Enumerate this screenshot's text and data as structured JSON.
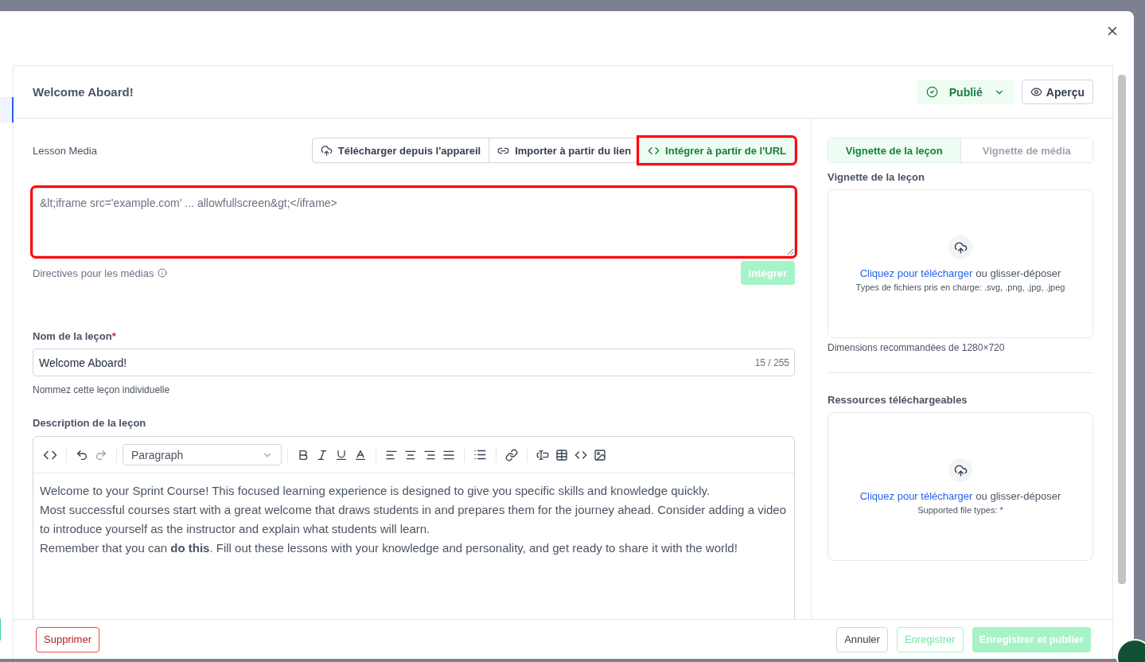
{
  "header": {
    "title": "Welcome Aboard!",
    "status": {
      "label": "Publié",
      "published": true
    },
    "preview_button": "Aperçu"
  },
  "media": {
    "label": "Lesson Media",
    "sources": [
      {
        "kind": "upload",
        "label": "Télécharger depuis l'appareil",
        "selected": false,
        "highlighted": false
      },
      {
        "kind": "link",
        "label": "Importer à partir du lien",
        "selected": false,
        "highlighted": false
      },
      {
        "kind": "code",
        "label": "Intégrer à partir de l'URL",
        "selected": true,
        "highlighted": true
      }
    ],
    "embed": {
      "placeholder": "&lt;iframe src='example.com' ... allowfullscreen&gt;</iframe>",
      "highlighted": true
    },
    "guidelines": "Directives pour les médias",
    "embed_button": {
      "label": "intégrer",
      "disabled": true
    }
  },
  "lesson_name": {
    "label": "Nom de la leçon",
    "required_mark": "*",
    "value": "Welcome Aboard!",
    "counter": "15 / 255",
    "hint": "Nommez cette leçon individuelle"
  },
  "description": {
    "label": "Description de la leçon",
    "block_format": "Paragraph",
    "paragraphs": [
      "Welcome to your Sprint Course! This focused learning experience is designed to give you specific skills and knowledge quickly.",
      "Most successful courses start with a great welcome that draws students in and prepares them for the journey ahead. Consider adding a video to introduce yourself as the instructor and explain what students will learn.",
      "Remember that you can **do this**. Fill out these lessons with your knowledge and personality, and get ready to share it with the world!"
    ]
  },
  "thumbnail": {
    "tabs": [
      {
        "label": "Vignette de la leçon",
        "selected": true
      },
      {
        "label": "Vignette de média",
        "selected": false
      }
    ],
    "label": "Vignette de la leçon",
    "upload": {
      "link": "Cliquez pour télécharger",
      "text": "ou glisser-déposer",
      "types": "Types de fichiers pris en charge: .svg, .png, .jpg, .jpeg"
    },
    "hint": "Dimensions recommandées de 1280×720"
  },
  "resources": {
    "label": "Ressources téléchargeables",
    "upload": {
      "link": "Cliquez pour télécharger",
      "text": "ou glisser-déposer",
      "types": "Supported file types: *"
    }
  },
  "footer": {
    "delete": "Supprimer",
    "cancel": "Annuler",
    "save": {
      "label": "Enregistrer",
      "disabled": true
    },
    "save_publish": {
      "label": "Enregistrer et publier",
      "disabled": true
    }
  }
}
